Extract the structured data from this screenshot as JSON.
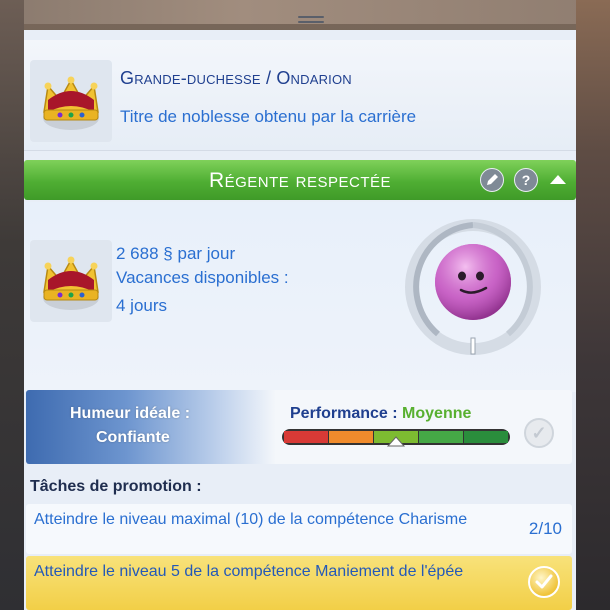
{
  "career": {
    "title": "Grande-duchesse / Ondarion",
    "subtitle": "Titre de noblesse obtenu par la carrière",
    "level_title": "Régente respectée",
    "pay_amount": "2 688",
    "currency_symbol": "§",
    "pay_suffix": "par jour",
    "vacation_label": "Vacances disponibles :",
    "vacation_days": "4 jours"
  },
  "performance": {
    "mood_label": "Humeur idéale :",
    "mood_value": "Confiante",
    "perf_label": "Performance :",
    "perf_value": "Moyenne",
    "level_fraction": 0.5
  },
  "tasks": {
    "header": "Tâches de promotion :",
    "items": [
      {
        "text": "Atteindre le niveau maximal (10) de la compétence Charisme",
        "count": "2/10",
        "done": false
      },
      {
        "text": "Atteindre le niveau 5 de la compétence Maniement de l'épée",
        "count": "",
        "done": true
      }
    ]
  },
  "icons": {
    "edit": "pencil-icon",
    "help": "question-icon",
    "collapse": "chevron-up-icon",
    "check": "check-icon",
    "crown": "crown-icon",
    "mood": "pink-sim-face-icon"
  },
  "colors": {
    "title_blue": "#1f3f8f",
    "link_blue": "#2a6fd1",
    "level_green": "#4fae33",
    "perf_green": "#58b030",
    "task_highlight": "#f2cf47"
  }
}
